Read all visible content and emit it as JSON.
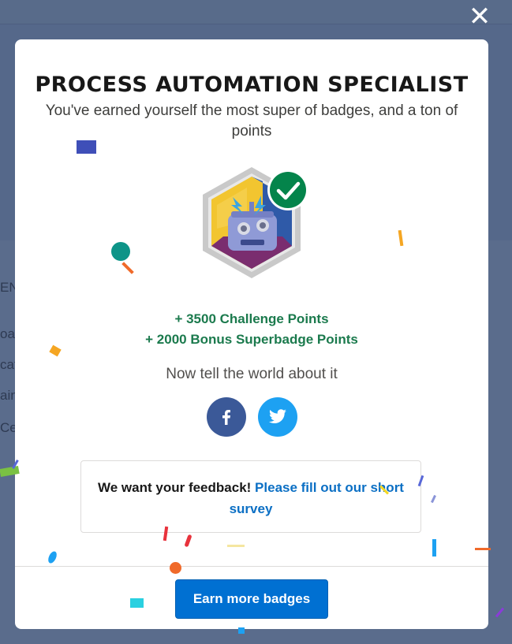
{
  "background": {
    "partial_texts": [
      "EN",
      "oa",
      "cat",
      "ain",
      "Ce"
    ]
  },
  "close_label": "✕",
  "modal": {
    "title": "PROCESS AUTOMATION SPECIALIST",
    "subtitle": "You've earned yourself the most super of badges, and a ton of points",
    "points": [
      "+ 3500 Challenge Points",
      "+ 2000 Bonus Superbadge Points"
    ],
    "share_prompt": "Now tell the world about it",
    "feedback": {
      "text": "We want your feedback!",
      "link": "Please fill out our short survey"
    },
    "cta_label": "Earn more badges"
  },
  "colors": {
    "accent": "#0070d2",
    "points_green": "#1b7a4d",
    "check_green": "#04844b",
    "facebook": "#3b5998",
    "twitter": "#1da1f2",
    "overlay": "#586b8a"
  },
  "icons": [
    "close-icon",
    "checkmark-icon",
    "facebook-icon",
    "twitter-icon",
    "robot-badge-icon"
  ]
}
